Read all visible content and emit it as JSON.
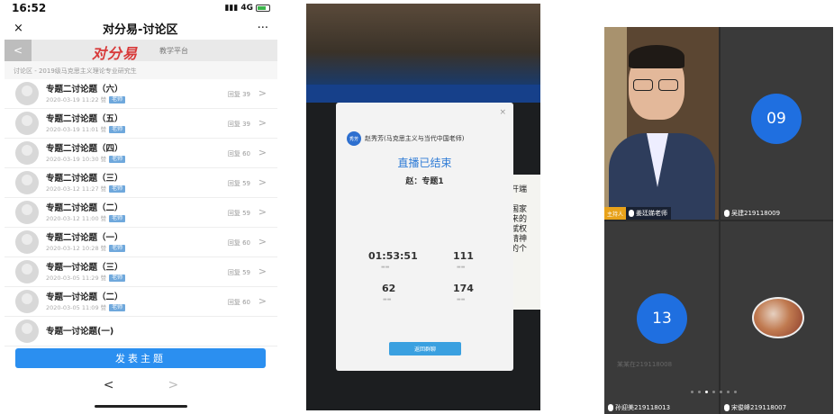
{
  "phone": {
    "status": {
      "time": "16:52",
      "signal": "4G"
    },
    "nav": {
      "close": "×",
      "title": "对分易-讨论区",
      "more": "···"
    },
    "brand": {
      "back": "<",
      "logo": "对分易",
      "sub": "教学平台"
    },
    "breadcrumb": "讨论区 - 2019级马克思主义理论专业研究生",
    "topics": [
      {
        "title": "专题二讨论题（六）",
        "meta": "2020-03-19 11:22 赞",
        "tag": "老师",
        "reply": "回复 39"
      },
      {
        "title": "专题二讨论题（五）",
        "meta": "2020-03-19 11:01 赞",
        "tag": "老师",
        "reply": "回复 39"
      },
      {
        "title": "专题二讨论题（四）",
        "meta": "2020-03-19 10:30 赞",
        "tag": "老师",
        "reply": "回复 60"
      },
      {
        "title": "专题二讨论题（三）",
        "meta": "2020-03-12 11:27 赞",
        "tag": "老师",
        "reply": "回复 59"
      },
      {
        "title": "专题二讨论题（二）",
        "meta": "2020-03-12 11:00 赞",
        "tag": "老师",
        "reply": "回复 59"
      },
      {
        "title": "专题二讨论题（一）",
        "meta": "2020-03-12 10:28 赞",
        "tag": "老师",
        "reply": "回复 60"
      },
      {
        "title": "专题一讨论题（三）",
        "meta": "2020-03-05 11:29 赞",
        "tag": "老师",
        "reply": "回复 59"
      },
      {
        "title": "专题一讨论题（二）",
        "meta": "2020-03-05 11:09 赞",
        "tag": "老师",
        "reply": "回复 60"
      },
      {
        "title": "专题一讨论题(一)",
        "meta": "",
        "tag": "",
        "reply": ""
      }
    ],
    "post_button": "发表主题",
    "bottom_nav": {
      "back": "<",
      "forward": ">"
    }
  },
  "live": {
    "close": "×",
    "host_avatar": "秀芳",
    "host_name": "赵秀芳(马克思主义与当代中国老师)",
    "title": "直播已结束",
    "subtitle": "赵：专题1",
    "stats": [
      {
        "value": "01:53:51"
      },
      {
        "value": "111"
      },
      {
        "value": "62"
      },
      {
        "value": "174"
      }
    ],
    "button": "返回群聊",
    "doc_text": "开端\n\n国家\n来的\n赋权\n精神\n的个"
  },
  "meeting": {
    "host_tag": "主持人",
    "tiles": [
      {
        "name": "姜廷娣老师"
      },
      {
        "name": "吴建219118009",
        "number": "09"
      },
      {
        "name": "孙迎美219118013",
        "number": "13"
      },
      {
        "name": "宋俊峰219118007"
      }
    ],
    "overlay": "某某在219118008"
  },
  "colors": {
    "accent": "#2b8ff0",
    "brand_red": "#d83a3a",
    "circle_blue": "#1f6fe0",
    "host_orange": "#e8a21a"
  }
}
